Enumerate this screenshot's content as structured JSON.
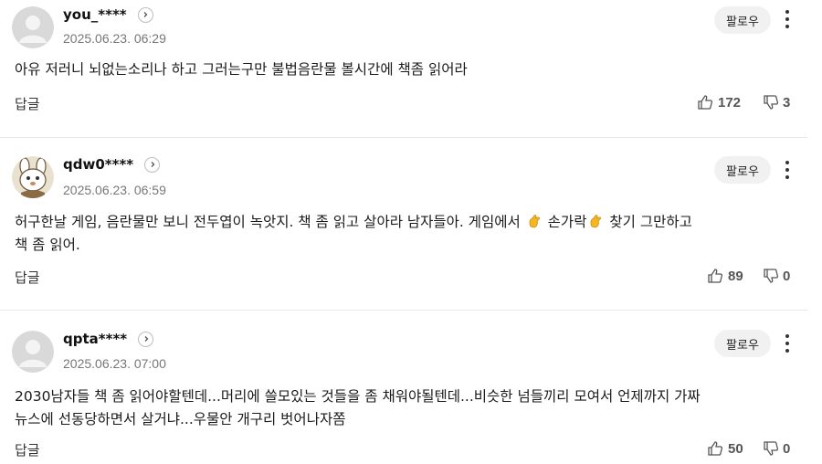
{
  "reply_label": "답글",
  "follow_label": "팔로우",
  "comments": [
    {
      "nickname": "you_****",
      "date": "2025.06.23. 06:29",
      "avatar": "default-avatar",
      "text_lines": [
        "아유 저러니 뇌없는소리나 하고 그러는구만 불법음란물 볼시간에 책좀 읽어라"
      ],
      "likes": "172",
      "dislikes": "3"
    },
    {
      "nickname": "qdw0****",
      "date": "2025.06.23. 06:59",
      "avatar": "cartoon-bunny-avatar",
      "text_segments": [
        "허구한날 게임, 음란물만 보니 전두엽이 녹앗지. 책 좀 읽고 살아라 남자들아. 게임에서 ",
        " 손가락",
        " 찾기 그만하고"
      ],
      "text_line2": "책 좀 읽어.",
      "likes": "89",
      "dislikes": "0"
    },
    {
      "nickname": "qpta****",
      "date": "2025.06.23. 07:00",
      "avatar": "default-avatar",
      "text_lines": [
        "2030남자들 책 좀 읽어야할텐데...머리에 쓸모있는 것들을 좀 채워야될텐데...비슷한 넘들끼리 모여서 언제까지 가짜",
        "뉴스에 선동당하면서 살거냐...우물안 개구리 벗어나자쫌"
      ],
      "likes": "50",
      "dislikes": "0"
    }
  ]
}
